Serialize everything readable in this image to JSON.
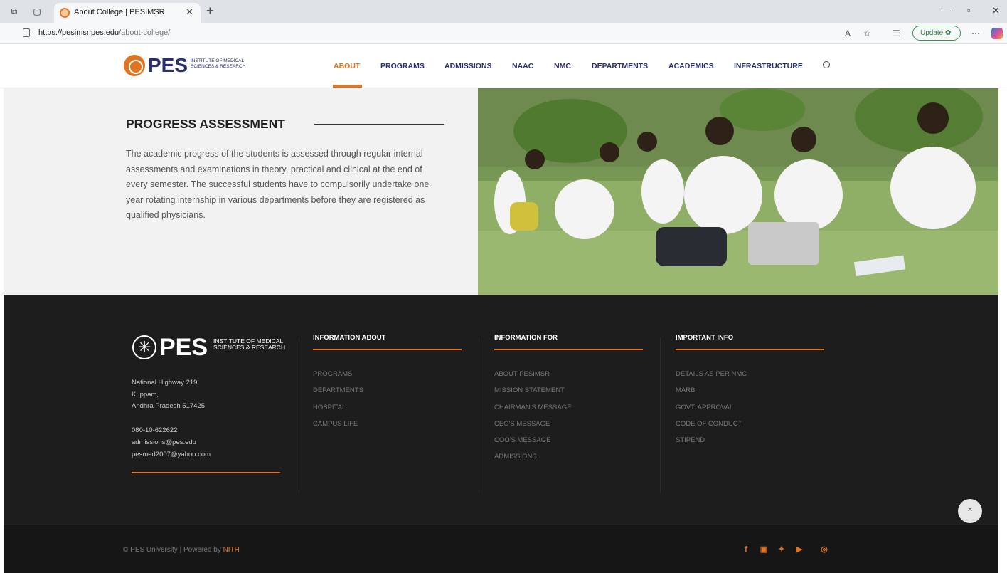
{
  "browser": {
    "tab_title": "About College | PESIMSR",
    "url_domain": "https://pesimsr.pes.edu",
    "url_path": "/about-college/",
    "update_label": "Update"
  },
  "site": {
    "logo_text": "PES",
    "logo_sub": "INSTITUTE OF MEDICAL SCIENCES & RESEARCH",
    "nav": [
      "ABOUT",
      "PROGRAMS",
      "ADMISSIONS",
      "NAAC",
      "NMC",
      "DEPARTMENTS",
      "ACADEMICS",
      "INFRASTRUCTURE"
    ],
    "active_nav": "ABOUT"
  },
  "section": {
    "title": "PROGRESS ASSESSMENT",
    "body": "The academic progress of the students is assessed through regular internal assessments and examinations in theory, practical and clinical at the end of every semester. The successful students have to compulsorily undertake one year rotating internship in various departments before they are registered as qualified physicians."
  },
  "footer": {
    "logo_text": "PES",
    "logo_sub": "INSTITUTE OF MEDICAL SCIENCES & RESEARCH",
    "address": [
      "National Highway 219",
      "Kuppam,",
      "Andhra Pradesh 517425"
    ],
    "contact": [
      "080-10-622622",
      "admissions@pes.edu",
      "pesmed2007@yahoo.com"
    ],
    "col1": {
      "heading": "INFORMATION ABOUT",
      "links": [
        "PROGRAMS",
        "DEPARTMENTS",
        "HOSPITAL",
        "CAMPUS LIFE"
      ]
    },
    "col2": {
      "heading": "INFORMATION FOR",
      "links": [
        "ABOUT PESIMSR",
        "MISSION STATEMENT",
        "CHAIRMAN'S MESSAGE",
        "CEO'S MESSAGE",
        "COO'S MESSAGE",
        "ADMISSIONS"
      ]
    },
    "col3": {
      "heading": "IMPORTANT INFO",
      "links": [
        "DETAILS AS PER NMC",
        "MARB",
        "GOVT. APPROVAL",
        "CODE OF CONDUCT",
        "STIPEND"
      ]
    },
    "copyright": "© PES University | Powered by ",
    "powered_by": "NITH"
  },
  "colors": {
    "accent": "#e2731f",
    "brand": "#2a2f6f",
    "footer_bg": "#1d1d1d"
  }
}
